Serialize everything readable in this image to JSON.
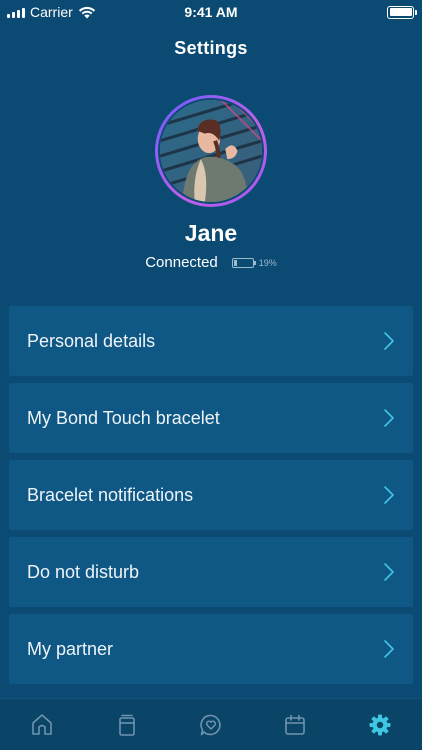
{
  "status_bar": {
    "carrier": "Carrier",
    "time": "9:41 AM"
  },
  "header": {
    "title": "Settings"
  },
  "profile": {
    "name": "Jane",
    "connection_status": "Connected",
    "bracelet_battery": "19%",
    "bracelet_battery_level": 0.19
  },
  "menu": [
    {
      "label": "Personal details"
    },
    {
      "label": "My Bond Touch bracelet"
    },
    {
      "label": "Bracelet notifications"
    },
    {
      "label": "Do not disturb"
    },
    {
      "label": "My partner"
    }
  ],
  "tabs": [
    {
      "icon": "home-icon",
      "active": false
    },
    {
      "icon": "journal-icon",
      "active": false
    },
    {
      "icon": "heart-chat-icon",
      "active": false
    },
    {
      "icon": "calendar-icon",
      "active": false
    },
    {
      "icon": "gear-icon",
      "active": true
    }
  ],
  "colors": {
    "background": "#0b4a72",
    "menu_item": "#0f5784",
    "accent": "#3ec7e0",
    "avatar_ring": "#a055f0"
  }
}
